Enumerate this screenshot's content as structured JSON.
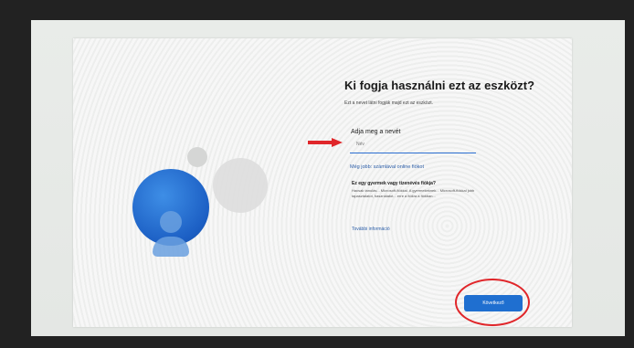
{
  "setup": {
    "title": "Ki fogja használni ezt az eszközt?",
    "subtitle": "Ezt a nevet látni fogják majd ezt az eszközt.",
    "name_label": "Adja meg a nevét",
    "name_placeholder": "Név",
    "link_online": "Még jobb: számlával online fiókot",
    "question_heading": "Ez egy gyermek vagy tizenévés fiókja?",
    "info_text": "Hacsak tanulás... Microsoft-fiókkal. A gyermekeknek... Microsoft-fiókkal jobb tapasztalatot, használatot... erre a fiókra a fiókban...",
    "more_info": "További információ",
    "next_button": "Következő"
  },
  "colors": {
    "accent": "#1f6fd0",
    "annotation": "#e0262a"
  },
  "icons": {
    "avatar": "user-avatar-icon",
    "arrow": "red-arrow-annotation"
  }
}
